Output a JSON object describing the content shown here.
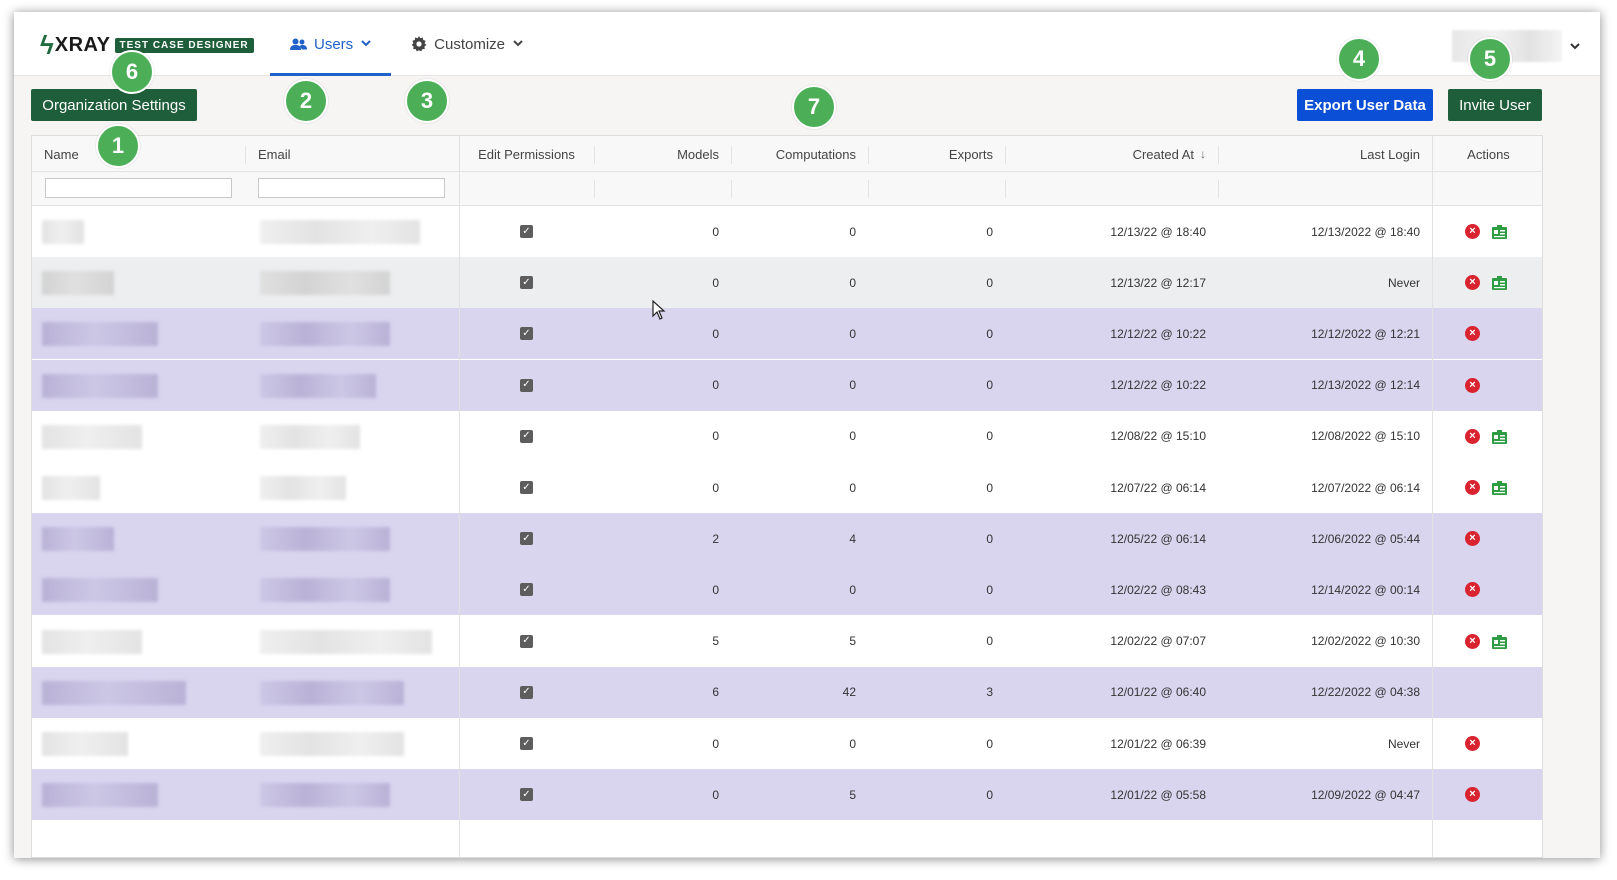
{
  "header": {
    "logo_text": "XRAY",
    "logo_tag": "TEST CASE DESIGNER",
    "nav": [
      {
        "label": "Users",
        "active": true,
        "icon": "users-icon"
      },
      {
        "label": "Customize",
        "active": false,
        "icon": "gear-icon"
      }
    ]
  },
  "toolbar": {
    "org_settings_label": "Organization Settings",
    "export_label": "Export User Data",
    "invite_label": "Invite User"
  },
  "badges": [
    "1",
    "2",
    "3",
    "4",
    "5",
    "6",
    "7"
  ],
  "columns": {
    "name": "Name",
    "email": "Email",
    "edit_permissions": "Edit Permissions",
    "models": "Models",
    "computations": "Computations",
    "exports": "Exports",
    "created_at": "Created At",
    "last_login": "Last Login",
    "actions": "Actions"
  },
  "filters": {
    "name": "",
    "email": ""
  },
  "colors": {
    "brand_green": "#1f5e3a",
    "export_blue": "#0b4fd6",
    "active_nav": "#2062c9",
    "row_purple": "#d9d5ef",
    "badge_green": "#4caf58",
    "delete_red": "#d92430",
    "card_green": "#2e9c43"
  },
  "rows": [
    {
      "edit": true,
      "models": "0",
      "computations": "0",
      "exports": "0",
      "created": "12/13/22 @ 18:40",
      "last_login": "12/13/2022 @ 18:40",
      "delete": true,
      "card": true,
      "shade": "white"
    },
    {
      "edit": true,
      "models": "0",
      "computations": "0",
      "exports": "0",
      "created": "12/13/22 @ 12:17",
      "last_login": "Never",
      "delete": true,
      "card": true,
      "shade": "grey"
    },
    {
      "edit": true,
      "models": "0",
      "computations": "0",
      "exports": "0",
      "created": "12/12/22 @ 10:22",
      "last_login": "12/12/2022 @ 12:21",
      "delete": true,
      "card": false,
      "shade": "purple"
    },
    {
      "edit": true,
      "models": "0",
      "computations": "0",
      "exports": "0",
      "created": "12/12/22 @ 10:22",
      "last_login": "12/13/2022 @ 12:14",
      "delete": true,
      "card": false,
      "shade": "purple"
    },
    {
      "edit": true,
      "models": "0",
      "computations": "0",
      "exports": "0",
      "created": "12/08/22 @ 15:10",
      "last_login": "12/08/2022 @ 15:10",
      "delete": true,
      "card": true,
      "shade": "white"
    },
    {
      "edit": true,
      "models": "0",
      "computations": "0",
      "exports": "0",
      "created": "12/07/22 @ 06:14",
      "last_login": "12/07/2022 @ 06:14",
      "delete": true,
      "card": true,
      "shade": "white"
    },
    {
      "edit": true,
      "models": "2",
      "computations": "4",
      "exports": "0",
      "created": "12/05/22 @ 06:14",
      "last_login": "12/06/2022 @ 05:44",
      "delete": true,
      "card": false,
      "shade": "purple"
    },
    {
      "edit": true,
      "models": "0",
      "computations": "0",
      "exports": "0",
      "created": "12/02/22 @ 08:43",
      "last_login": "12/14/2022 @ 00:14",
      "delete": true,
      "card": false,
      "shade": "purple"
    },
    {
      "edit": true,
      "models": "5",
      "computations": "5",
      "exports": "0",
      "created": "12/02/22 @ 07:07",
      "last_login": "12/02/2022 @ 10:30",
      "delete": true,
      "card": true,
      "shade": "white"
    },
    {
      "edit": true,
      "models": "6",
      "computations": "42",
      "exports": "3",
      "created": "12/01/22 @ 06:40",
      "last_login": "12/22/2022 @ 04:38",
      "delete": false,
      "card": false,
      "shade": "purple"
    },
    {
      "edit": true,
      "models": "0",
      "computations": "0",
      "exports": "0",
      "created": "12/01/22 @ 06:39",
      "last_login": "Never",
      "delete": true,
      "card": false,
      "shade": "white"
    },
    {
      "edit": true,
      "models": "0",
      "computations": "5",
      "exports": "0",
      "created": "12/01/22 @ 05:58",
      "last_login": "12/09/2022 @ 04:47",
      "delete": true,
      "card": false,
      "shade": "purple"
    }
  ]
}
